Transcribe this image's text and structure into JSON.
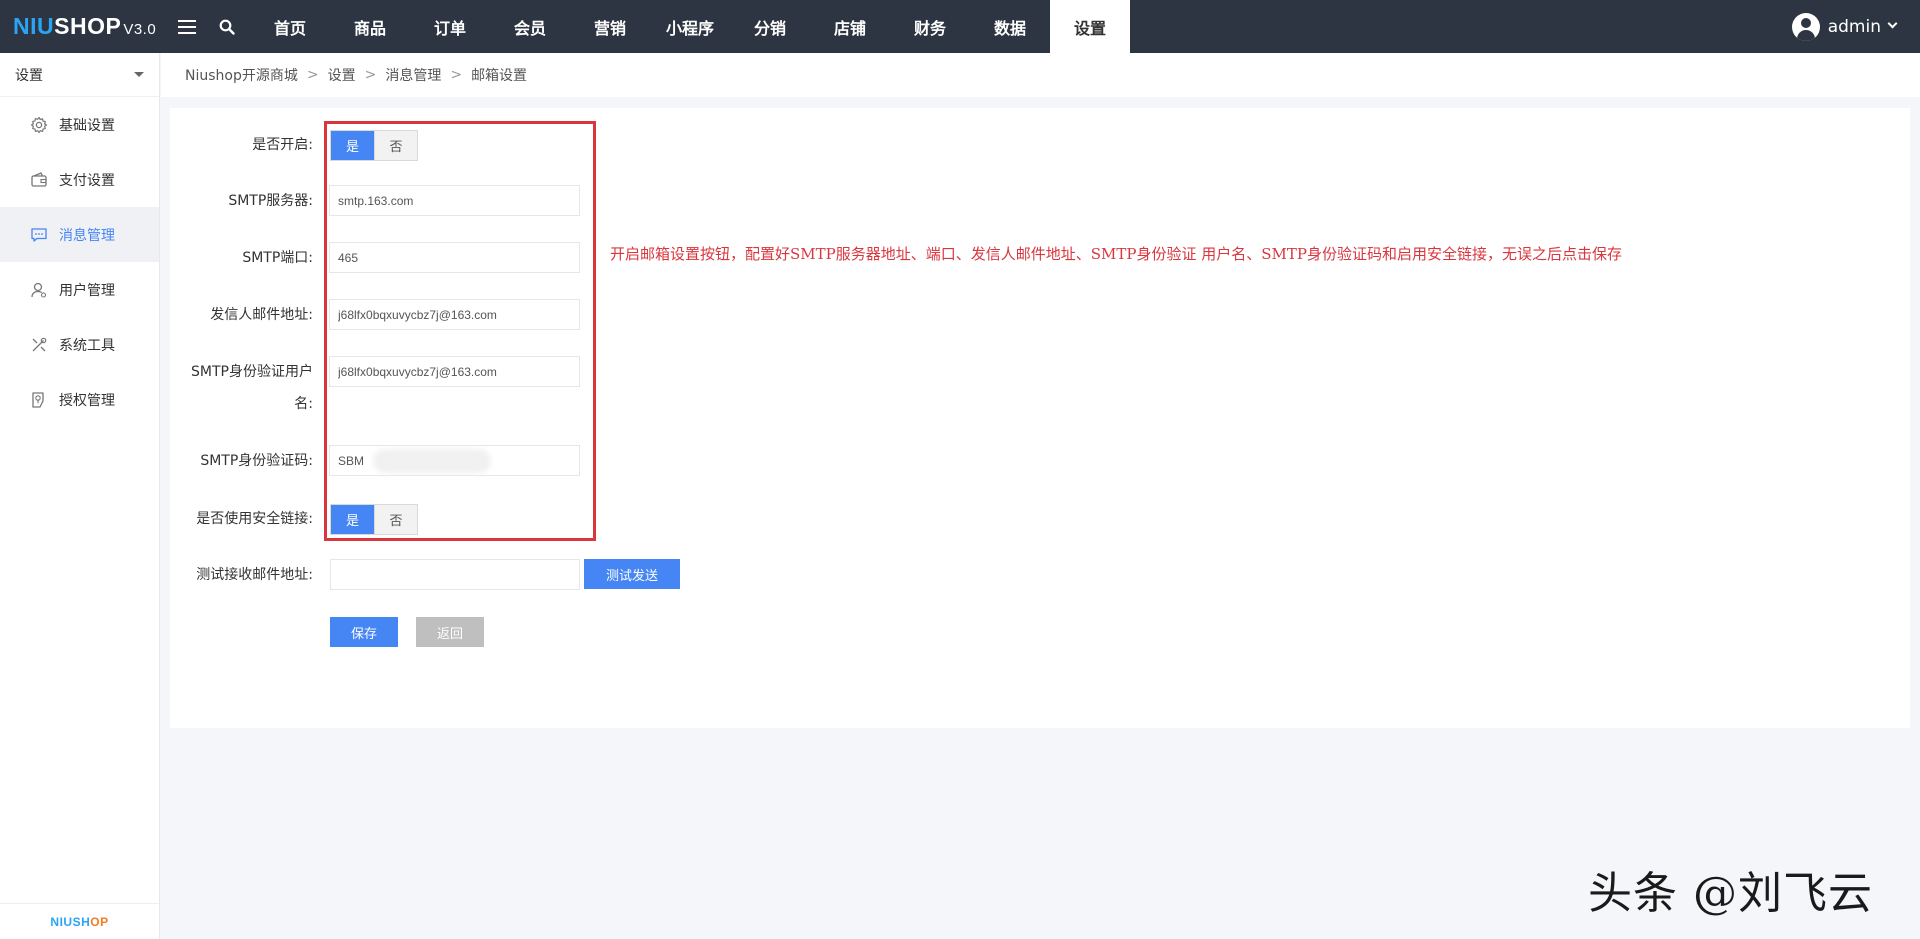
{
  "brand": {
    "logo_a": "NIU",
    "logo_b": "SHOP",
    "version": "V3.0"
  },
  "nav": {
    "items": [
      "首页",
      "商品",
      "订单",
      "会员",
      "营销",
      "小程序",
      "分销",
      "店铺",
      "财务",
      "数据",
      "设置"
    ],
    "active": "设置"
  },
  "user": {
    "name": "admin"
  },
  "sidebar": {
    "heading": "设置",
    "items": [
      {
        "label": "基础设置",
        "icon": "gear-icon"
      },
      {
        "label": "支付设置",
        "icon": "wallet-icon"
      },
      {
        "label": "消息管理",
        "icon": "message-icon"
      },
      {
        "label": "用户管理",
        "icon": "user-icon"
      },
      {
        "label": "系统工具",
        "icon": "tools-icon"
      },
      {
        "label": "授权管理",
        "icon": "license-icon"
      }
    ],
    "active": "消息管理",
    "footer_a": "NIUSH",
    "footer_b": "OP"
  },
  "breadcrumb": [
    "Niushop开源商城",
    "设置",
    "消息管理",
    "邮箱设置"
  ],
  "form": {
    "enable_label": "是否开启:",
    "yes": "是",
    "no": "否",
    "smtp_server_label": "SMTP服务器:",
    "smtp_server_value": "smtp.163.com",
    "smtp_port_label": "SMTP端口:",
    "smtp_port_value": "465",
    "sender_label": "发信人邮件地址:",
    "sender_value": "j68lfx0bqxuvycbz7j@163.com",
    "auth_user_label_1": "SMTP身份验证用户",
    "auth_user_label_2": "名:",
    "auth_user_value": "j68lfx0bqxuvycbz7j@163.com",
    "auth_code_label": "SMTP身份验证码:",
    "auth_code_value": "SBM",
    "ssl_label": "是否使用安全链接:",
    "test_label": "测试接收邮件地址:",
    "test_value": "",
    "test_button": "测试发送",
    "save_button": "保存",
    "back_button": "返回"
  },
  "annotation": "开启邮箱设置按钮，配置好SMTP服务器地址、端口、发信人邮件地址、SMTP身份验证 用户名、SMTP身份验证码和启用安全链接，无误之后点击保存",
  "watermark": "头条 @刘飞云",
  "colors": {
    "topbar": "#2d3542",
    "primary": "#4685f4",
    "highlight": "#d9363e"
  }
}
